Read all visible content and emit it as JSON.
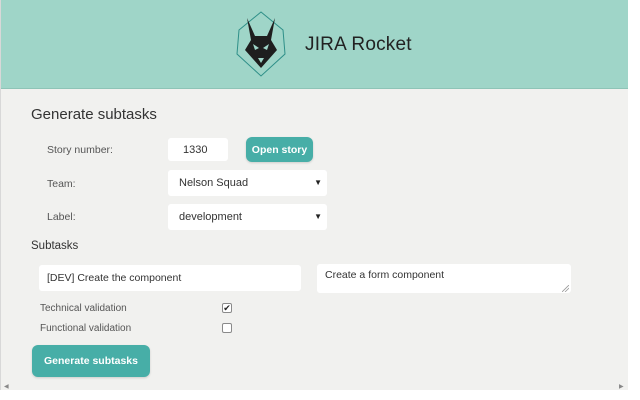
{
  "header": {
    "title": "JIRA Rocket",
    "logo_icon": "fox-logo-icon",
    "background_color": "#9fd5c8"
  },
  "form": {
    "title": "Generate subtasks",
    "story_number": {
      "label": "Story number:",
      "value": "1330"
    },
    "open_story_label": "Open story",
    "team": {
      "label": "Team:",
      "selected": "Nelson Squad"
    },
    "label_field": {
      "label": "Label:",
      "selected": "development"
    }
  },
  "subtasks": {
    "title": "Subtasks",
    "items": [
      {
        "name": "[DEV] Create the component",
        "description": "Create a form component"
      }
    ]
  },
  "validations": {
    "technical": {
      "label": "Technical validation",
      "checked": true
    },
    "functional": {
      "label": "Functional validation",
      "checked": false
    }
  },
  "generate_label": "Generate subtasks",
  "accent_color": "#47aea7",
  "glyphs": {
    "caret": "▼",
    "check": "✔",
    "scroll_left": "◀",
    "scroll_right": "▶"
  }
}
